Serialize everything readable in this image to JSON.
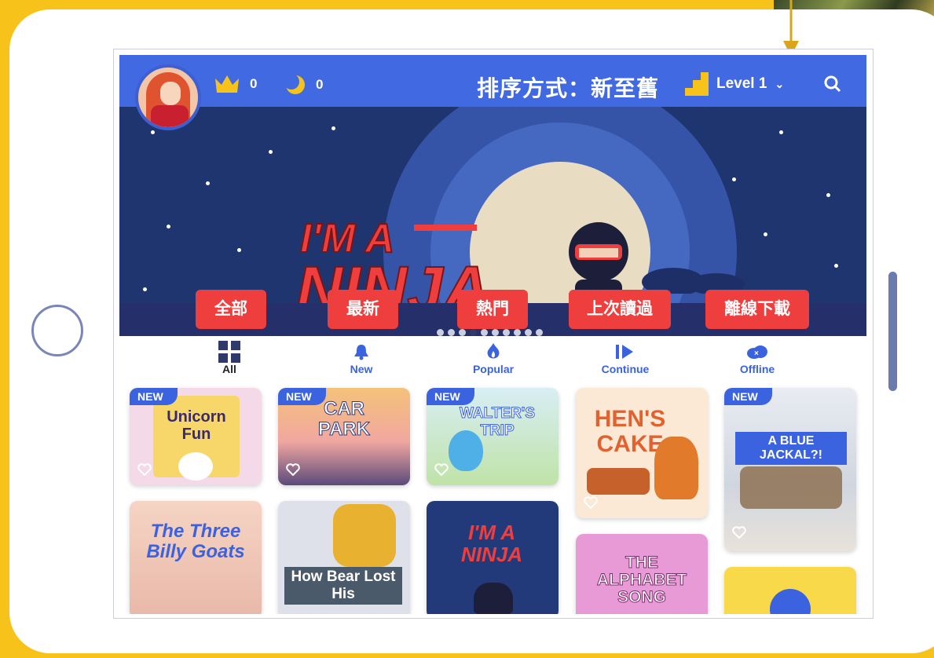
{
  "header": {
    "crown_count": "0",
    "moon_count": "0",
    "sort_label": "排序方式：新至舊",
    "level_label": "Level 1"
  },
  "banner": {
    "title_line1": "I'M A",
    "title_line2": "NINJA"
  },
  "filters": [
    "全部",
    "最新",
    "熱門",
    "上次讀過",
    "離線下載"
  ],
  "tabs": [
    "All",
    "New",
    "Popular",
    "Continue",
    "Offline"
  ],
  "badge_new": "NEW",
  "books": [
    {
      "title": "Unicorn Fun",
      "badge": "NEW"
    },
    {
      "title": "CAR PARK",
      "badge": "NEW"
    },
    {
      "title": "WALTER'S TRIP",
      "badge": "NEW"
    },
    {
      "title": "HEN'S CAKE"
    },
    {
      "title": "A BLUE JACKAL?!",
      "badge": "NEW"
    },
    {
      "title": "The Three Billy Goats"
    },
    {
      "title": "How Bear Lost His"
    },
    {
      "title": "I'M A NINJA"
    },
    {
      "title": "THE ALPHABET SONG"
    },
    {
      "title": ""
    }
  ],
  "colors": {
    "accent": "#4169e1",
    "pill": "#ef3e3e",
    "frame": "#f7c21a"
  }
}
